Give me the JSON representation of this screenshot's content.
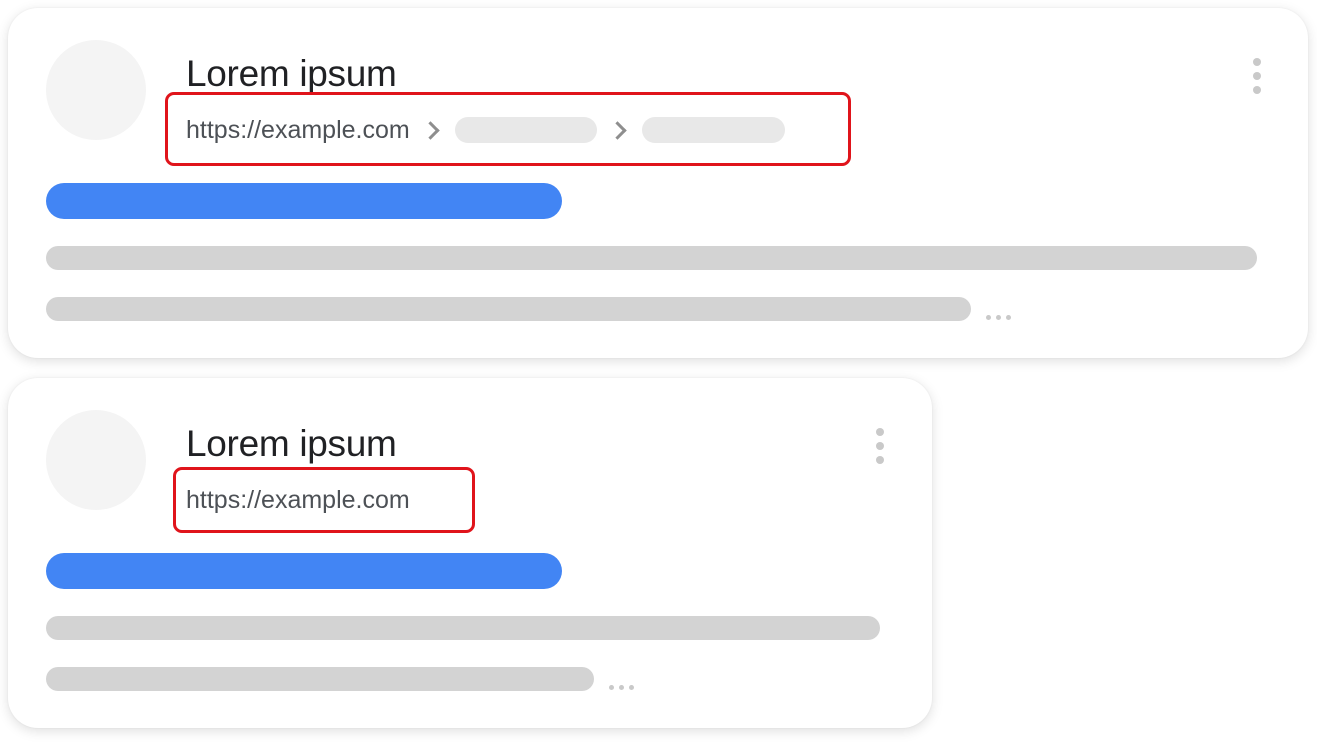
{
  "cards": [
    {
      "title": "Lorem ipsum",
      "url": "https://example.com",
      "breadcrumbs_shown": 2,
      "highlighted": "url-row-with-breadcrumbs"
    },
    {
      "title": "Lorem ipsum",
      "url": "https://example.com",
      "breadcrumbs_shown": 0,
      "highlighted": "url-only"
    }
  ],
  "icons": {
    "menu": "more-vert-icon",
    "breadcrumb_separator": "chevron-right-icon",
    "truncation": "ellipsis-icon"
  },
  "colors": {
    "title": "#202124",
    "url": "#4d5156",
    "link_bar": "#4285f4",
    "placeholder": "#d3d3d3",
    "highlight_box": "#e0141b"
  }
}
